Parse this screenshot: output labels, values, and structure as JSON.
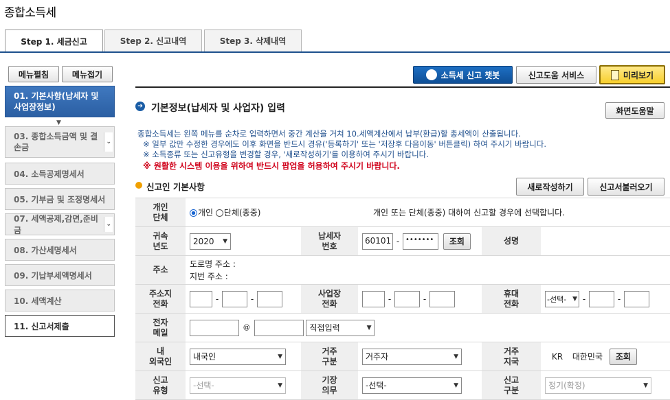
{
  "page": {
    "title": "종합소득세"
  },
  "tabs": [
    {
      "label": "Step 1. 세금신고"
    },
    {
      "label": "Step 2. 신고내역"
    },
    {
      "label": "Step 3. 삭제내역"
    }
  ],
  "sidebar": {
    "expand_label": "메뉴펼침",
    "collapse_label": "메뉴접기",
    "items": [
      {
        "label": "01. 기본사항(납세자 및 사업장정보)"
      },
      {
        "label": "03. 종합소득금액 및 결손금"
      },
      {
        "label": "04. 소득공제명세서"
      },
      {
        "label": "05. 기부금 및 조정명세서"
      },
      {
        "label": "07. 세액공제,감면,준비금"
      },
      {
        "label": "08. 가산세명세서"
      },
      {
        "label": "09. 기납부세액명세서"
      },
      {
        "label": "10. 세액계산"
      },
      {
        "label": "11. 신고서제출"
      }
    ]
  },
  "toolbar": {
    "chatbot_label": "소득세 신고 챗봇",
    "help_service_label": "신고도움 서비스",
    "preview_label": "미리보기"
  },
  "section": {
    "title": "기본정보(납세자 및 사업자) 입력",
    "screen_help_label": "화면도움말",
    "info_lines": [
      "종합소득세는 왼쪽 메뉴를 순차로 입력하면서 중간 계산을 거쳐 10.세액계산에서 납부(환급)할 총세액이 산출됩니다.",
      "※ 일부 값만 수정한 경우에도 이후 화면을 반드시 경유('등록하기' 또는 '저장후 다음이동' 버튼클릭) 하여 주시기 바랍니다.",
      "※ 소득종류 또는 신고유형을 변경할 경우, '새로작성하기'를 이용하여 주시기 바랍니다."
    ],
    "warning": "※ 원활한 시스템 이용을 위하여 반드시 팝업을 허용하여 주시기 바랍니다."
  },
  "filer": {
    "title": "신고인 기본사항",
    "new_label": "새로작성하기",
    "load_label": "신고서불러오기",
    "type_label": "개인\n단체",
    "type_individual": "개인",
    "type_group": "단체(종중)",
    "type_desc": "개인 또는 단체(종중) 대하여 신고할 경우에 선택합니다.",
    "year_label": "귀속\n년도",
    "year_value": "2020",
    "taxpayer_no_label": "납세자\n번호",
    "taxpayer_no_front": "60101",
    "taxpayer_no_back": "•••••••",
    "lookup_label": "조회",
    "name_label": "성명",
    "address_label": "주소",
    "road_address": "도로명 주소 :",
    "lot_address": "지번 주소 :",
    "home_phone_label": "주소지\n전화",
    "biz_phone_label": "사업장\n전화",
    "mobile_label": "휴대\n전화",
    "mobile_select": "-선택-",
    "email_label": "전자\n메일",
    "email_at": "@",
    "email_domain_select": "직접입력",
    "nationality_label": "내\n외국인",
    "nationality_value": "내국인",
    "residency_label": "거주\n구분",
    "residency_value": "거주자",
    "residence_country_label": "거주\n지국",
    "country_code": "KR",
    "country_name": "대한민국",
    "filing_type_label": "신고\n유형",
    "filing_type_value": "-선택-",
    "bookkeeping_label": "기장\n의무",
    "bookkeeping_value": "-선택-",
    "filing_class_label": "신고\n구분",
    "filing_class_value": "정기(확정)"
  },
  "colors": {
    "accent": "#1c4f8c",
    "info_text": "#1f4f8d",
    "warning": "#d0021b",
    "preview_bg": "#f7cf2d"
  }
}
